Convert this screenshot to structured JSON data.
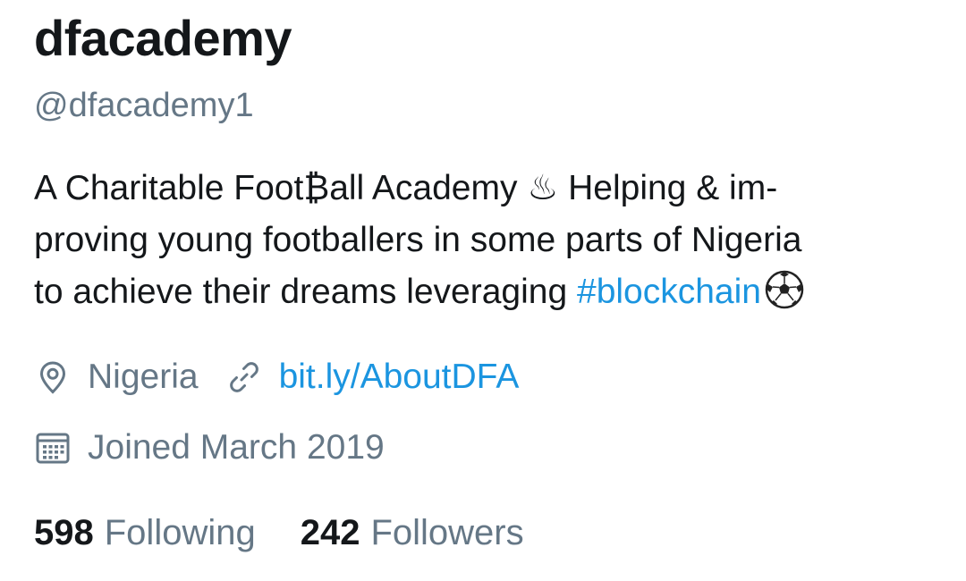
{
  "profile": {
    "display_name": "dfacademy",
    "handle": "@dfacademy1",
    "bio": {
      "line1": "A Charitable Foot₿all Academy ♨ Helping & im-",
      "line2": "proving young footballers in some parts of Nigeria",
      "line3_text": "to achieve their dreams leveraging ",
      "hashtag": "#blockchain",
      "emoji": "soccer-ball-icon"
    },
    "location": "Nigeria",
    "website": "bit.ly/AboutDFA",
    "joined": "Joined March 2019",
    "stats": {
      "following_count": "598",
      "following_label": "Following",
      "followers_count": "242",
      "followers_label": "Followers"
    }
  },
  "colors": {
    "text": "#14171a",
    "secondary": "#657786",
    "link": "#1b95e0"
  },
  "icons": {
    "location": "location-pin-icon",
    "link": "link-icon",
    "calendar": "calendar-icon"
  }
}
